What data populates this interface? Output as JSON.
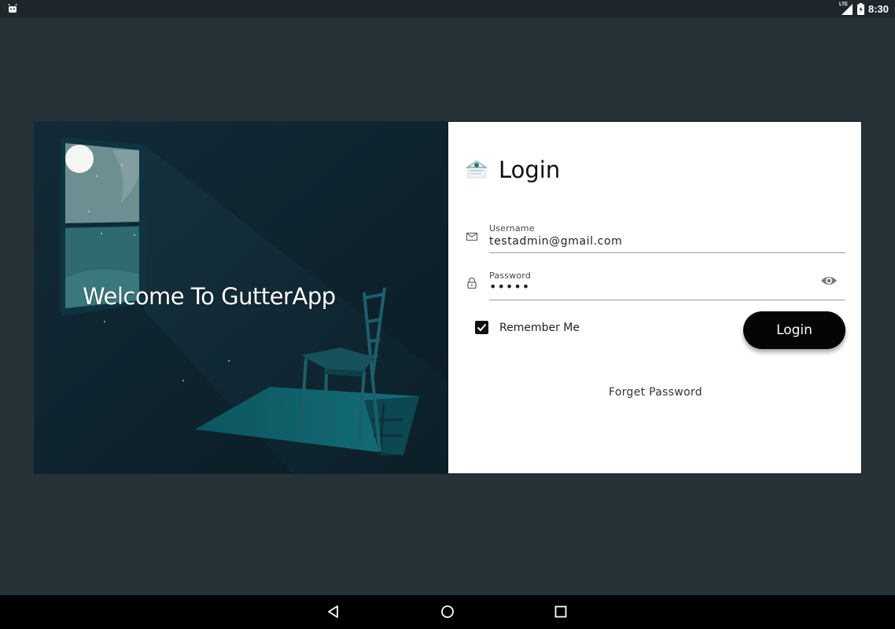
{
  "status_bar": {
    "network": "LTE",
    "time": "8:30",
    "icons": [
      "android-icon",
      "signal-icon",
      "battery-icon"
    ]
  },
  "hero": {
    "welcome_text": "Welcome To GutterApp"
  },
  "login_form": {
    "title": "Login",
    "username": {
      "label": "Username",
      "value": "testadmin@gmail.com",
      "icon": "mail-icon"
    },
    "password": {
      "label": "Password",
      "value": "•••••",
      "icon": "lock-icon",
      "toggle_icon": "eye-icon"
    },
    "remember_me": {
      "label": "Remember Me",
      "checked": true
    },
    "login_button": "Login",
    "forget_password": "Forget Password"
  },
  "nav_bar": {
    "buttons": [
      "back-icon",
      "home-icon",
      "recents-icon"
    ]
  },
  "colors": {
    "background": "#263238",
    "hero_background": "#0e2430",
    "button": "#050505",
    "accent_teal": "#1f6e78"
  }
}
